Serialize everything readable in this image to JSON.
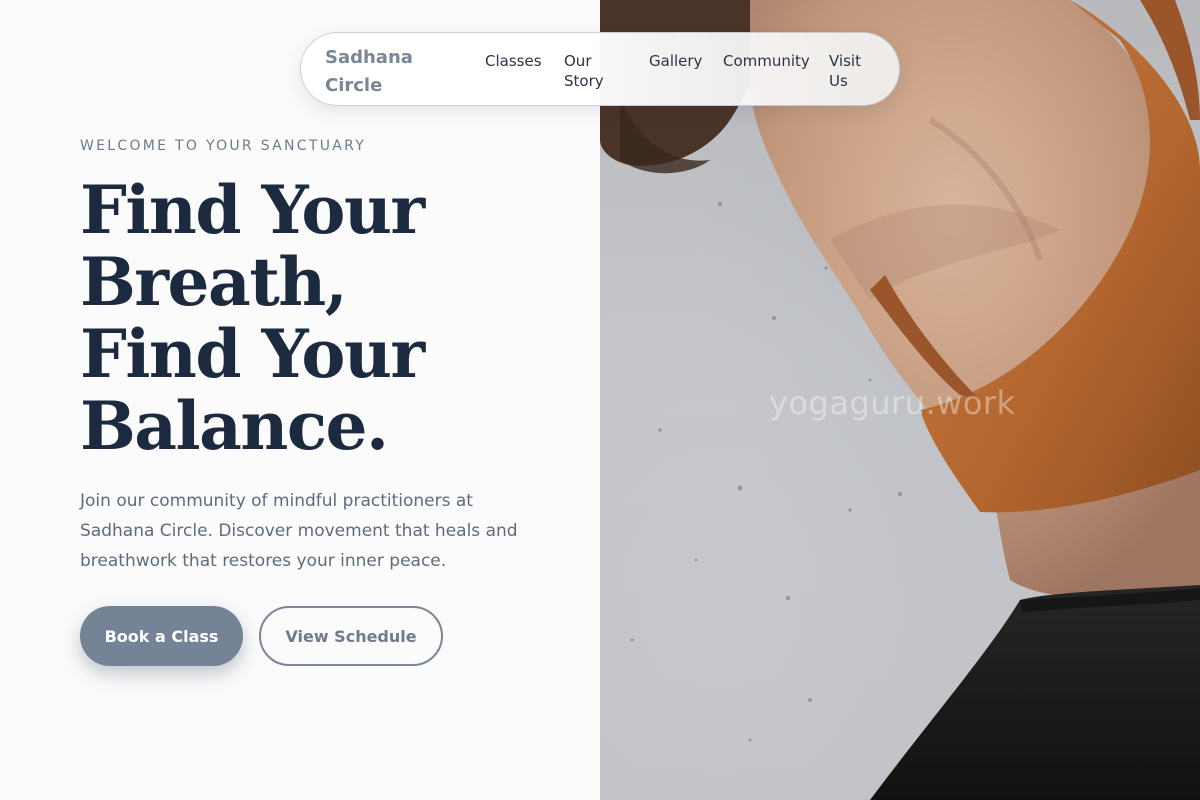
{
  "brand": {
    "name": "Sadhana Circle"
  },
  "nav": {
    "items": [
      {
        "label": "Classes"
      },
      {
        "label": "Our Story"
      },
      {
        "label": "Gallery"
      },
      {
        "label": "Community"
      },
      {
        "label": "Visit Us"
      }
    ]
  },
  "hero": {
    "eyebrow": "WELCOME TO YOUR SANCTUARY",
    "headline_lines": [
      "Find Your",
      "Breath,",
      "Find Your",
      "Balance."
    ],
    "intro": "Join our community of mindful practitioners at Sadhana Circle. Discover movement that heals and breathwork that restores your inner peace.",
    "primary_cta": "Book a Class",
    "secondary_cta": "View Schedule",
    "image_watermark": "yogaguru.work"
  },
  "colors": {
    "heading": "#1c2a3f",
    "accent": "#758397",
    "muted_text": "#5f6b7c",
    "page_background": "#fbfbfb",
    "top_color": "#b8692f",
    "shorts_color": "#1a1a1a"
  },
  "icons": {}
}
